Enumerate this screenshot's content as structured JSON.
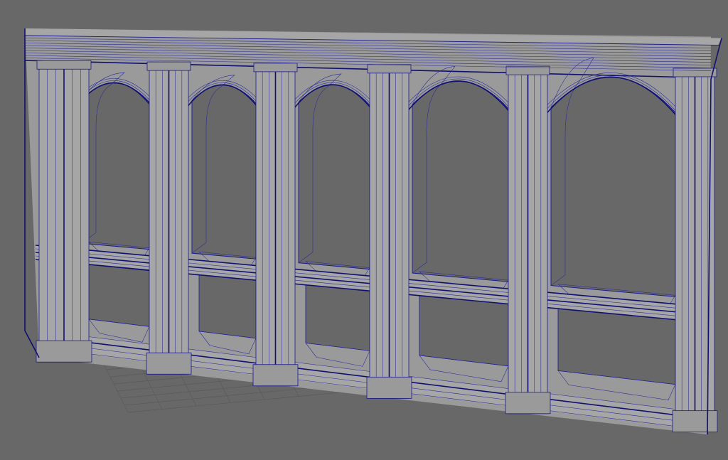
{
  "viewport": {
    "background": "#686868",
    "mesh_fill": "#9a9a9a",
    "mesh_fill_shadow": "#7e7e7e",
    "mesh_fill_light": "#a6a6a6",
    "wireframe_color": "#1a1a8c",
    "grid_color": "#5a5a5a"
  },
  "model": {
    "object": "arcade-wall",
    "arch_count": 5,
    "display_mode": "wireframe-on-shaded"
  }
}
